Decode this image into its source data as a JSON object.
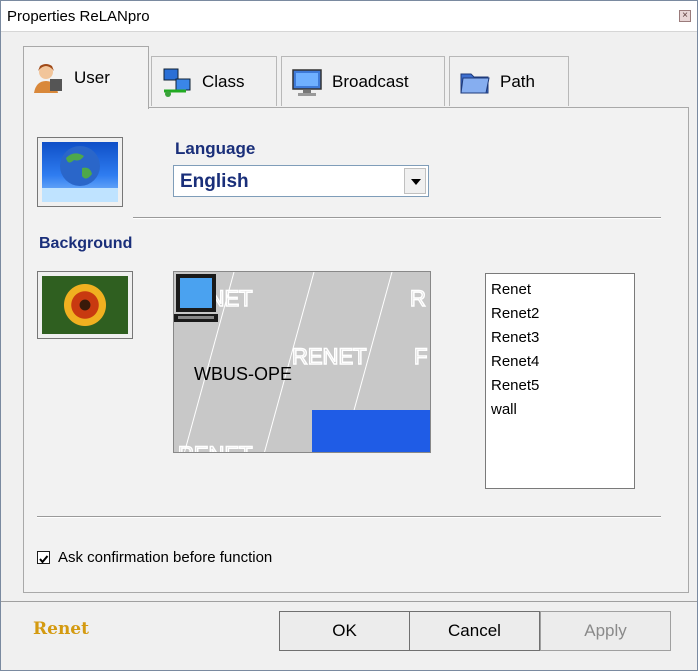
{
  "window": {
    "title": "Properties ReLANpro"
  },
  "tabs": [
    {
      "label": "User",
      "icon": "user-icon",
      "active": true
    },
    {
      "label": "Class",
      "icon": "network-class-icon",
      "active": false
    },
    {
      "label": "Broadcast",
      "icon": "monitor-icon",
      "active": false
    },
    {
      "label": "Path",
      "icon": "folder-icon",
      "active": false
    }
  ],
  "language": {
    "label": "Language",
    "value": "English"
  },
  "background": {
    "label": "Background",
    "preview": {
      "watermark": "RENET",
      "computer_name": "WBUS-OPE"
    },
    "wallpapers": [
      "Renet",
      "Renet2",
      "Renet3",
      "Renet4",
      "Renet5",
      "wall"
    ]
  },
  "confirm": {
    "label": "Ask confirmation before function",
    "checked": true
  },
  "footer": {
    "logo": "Renet"
  },
  "buttons": {
    "ok": "OK",
    "cancel": "Cancel",
    "apply": "Apply"
  },
  "colors": {
    "accent_blue": "#1a2f7a",
    "preview_blue": "#1f5ce6",
    "logo_gold": "#d49a10"
  }
}
